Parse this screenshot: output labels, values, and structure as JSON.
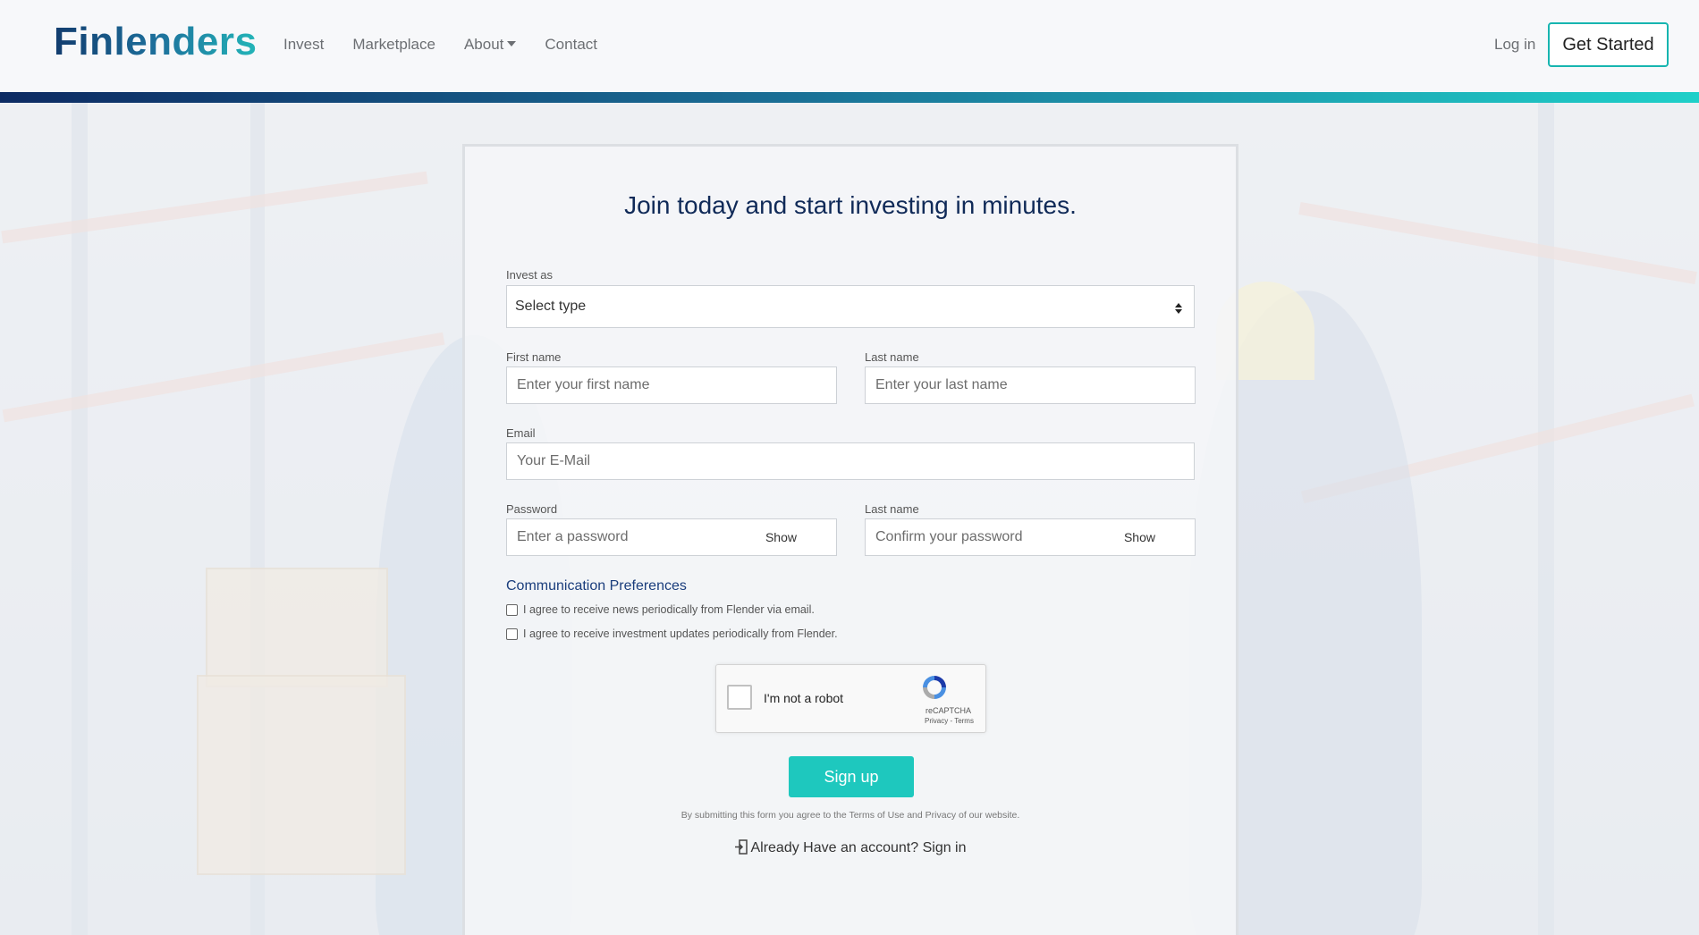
{
  "brand": {
    "name": "Finlenders"
  },
  "nav": {
    "links": [
      {
        "label": "Invest"
      },
      {
        "label": "Marketplace"
      },
      {
        "label": "About"
      },
      {
        "label": "Contact"
      }
    ],
    "login_label": "Log in",
    "cta_label": "Get Started"
  },
  "form": {
    "title": "Join today and start investing in minutes.",
    "invest_as": {
      "label": "Invest as",
      "value": "Select type"
    },
    "first_name": {
      "label": "First name",
      "placeholder": "Enter your first name"
    },
    "last_name": {
      "label": "Last name",
      "placeholder": "Enter your last name"
    },
    "email": {
      "label": "Email",
      "placeholder": "Your E-Mail"
    },
    "password": {
      "label": "Password",
      "placeholder": "Enter a password",
      "show_label": "Show"
    },
    "confirm_password": {
      "label": "Last name",
      "placeholder": "Confirm your password",
      "show_label": "Show"
    },
    "preferences": {
      "title": "Communication Preferences",
      "items": [
        {
          "label": "I agree to receive news periodically from Flender via email."
        },
        {
          "label": "I agree to receive investment updates periodically from Flender."
        }
      ]
    },
    "recaptcha": {
      "label": "I'm not a robot",
      "brand": "reCAPTCHA",
      "links": "Privacy - Terms"
    },
    "submit_label": "Sign up",
    "terms_text": "By submitting this form you agree to the Terms of Use and Privacy of our website.",
    "signin_text": "Already Have an account? Sign in"
  },
  "colors": {
    "accent": "#1ec8be",
    "title": "#102a58",
    "brand_gradient": [
      "#123c6e",
      "#23b5b8"
    ]
  }
}
